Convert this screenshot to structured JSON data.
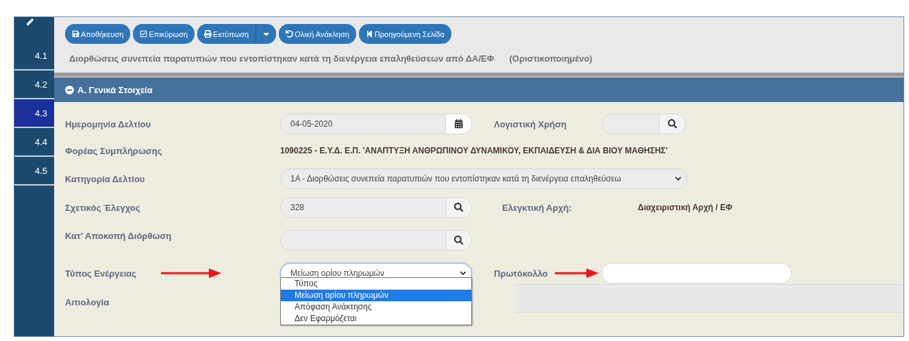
{
  "sidebar": {
    "items": [
      {
        "label": "4.1",
        "selected": false
      },
      {
        "label": "4.2",
        "selected": false
      },
      {
        "label": "4.3",
        "selected": true
      },
      {
        "label": "4.4",
        "selected": false
      },
      {
        "label": "4.5",
        "selected": false
      }
    ]
  },
  "toolbar": {
    "buttons": [
      {
        "kind": "save",
        "label": "Αποθήκευση",
        "has_menu": false
      },
      {
        "kind": "validate",
        "label": "Επικύρωση",
        "has_menu": false
      },
      {
        "kind": "print",
        "label": "Εκτύπωση",
        "has_menu": true
      },
      {
        "kind": "revoke",
        "label": "Ολική Ανάκληση",
        "has_menu": false
      },
      {
        "kind": "back",
        "label": "Προηγούμενη Σελίδα",
        "has_menu": false
      }
    ]
  },
  "page_title": "Διορθώσεις συνεπεία παρατυπιών που εντοπίστηκαν κατά τη διενέργεια επαληθεύσεων από ΔΑ/ΕΦ",
  "status": "(Οριστικοποιημένο)",
  "section": {
    "title": "Α. Γενικά Στοιχεία",
    "expanded": true
  },
  "form": {
    "date": {
      "label": "Ημερομηνία Δελτίου",
      "value": "04-05-2020"
    },
    "fiscal_year": {
      "label": "Λογιστική Χρήση"
    },
    "agency": {
      "label": "Φορέας Συμπλήρωσης",
      "value": "1090225 - Ε.Υ.Δ. Ε.Π. 'ΑΝΑΠΤΥΞΗ ΑΝΘΡΩΠΙΝΟΥ ΔΥΝΑΜΙΚΟΥ, ΕΚΠΑΙΔΕΥΣΗ & ΔΙΑ ΒΙΟΥ ΜΑΘΗΣΗΣ'"
    },
    "category": {
      "label": "Κατηγορία Δελτίου",
      "value": "1Α - Διορθώσεις συνεπεία παρατυπιών που εντοπίστηκαν κατά τη διενέργεια επαληθεύσεω"
    },
    "related_audit": {
      "label": "Σχετικός Έλεγχος",
      "value": "328"
    },
    "audit_authority": {
      "label": "Ελεγκτική Αρχή:",
      "value": "Διαχειριστική Αρχή / ΕΦ"
    },
    "flat_rate": {
      "label": "Κατ' Αποκοπή Διόρθωση"
    },
    "action_type": {
      "label": "Τύπος Ενέργειας",
      "value": "Μείωση ορίου πληρωμών",
      "open": true,
      "options": [
        {
          "label": "Τύπος",
          "selected": false
        },
        {
          "label": "Μείωση ορίου πληρωμών",
          "selected": true
        },
        {
          "label": "Απόφαση Ανάκτησης",
          "selected": false
        },
        {
          "label": "Δεν Εφαρμόζεται",
          "selected": false
        }
      ]
    },
    "protocol": {
      "label": "Πρωτόκολλο"
    },
    "justification": {
      "label": "Αιτιολογία"
    }
  }
}
